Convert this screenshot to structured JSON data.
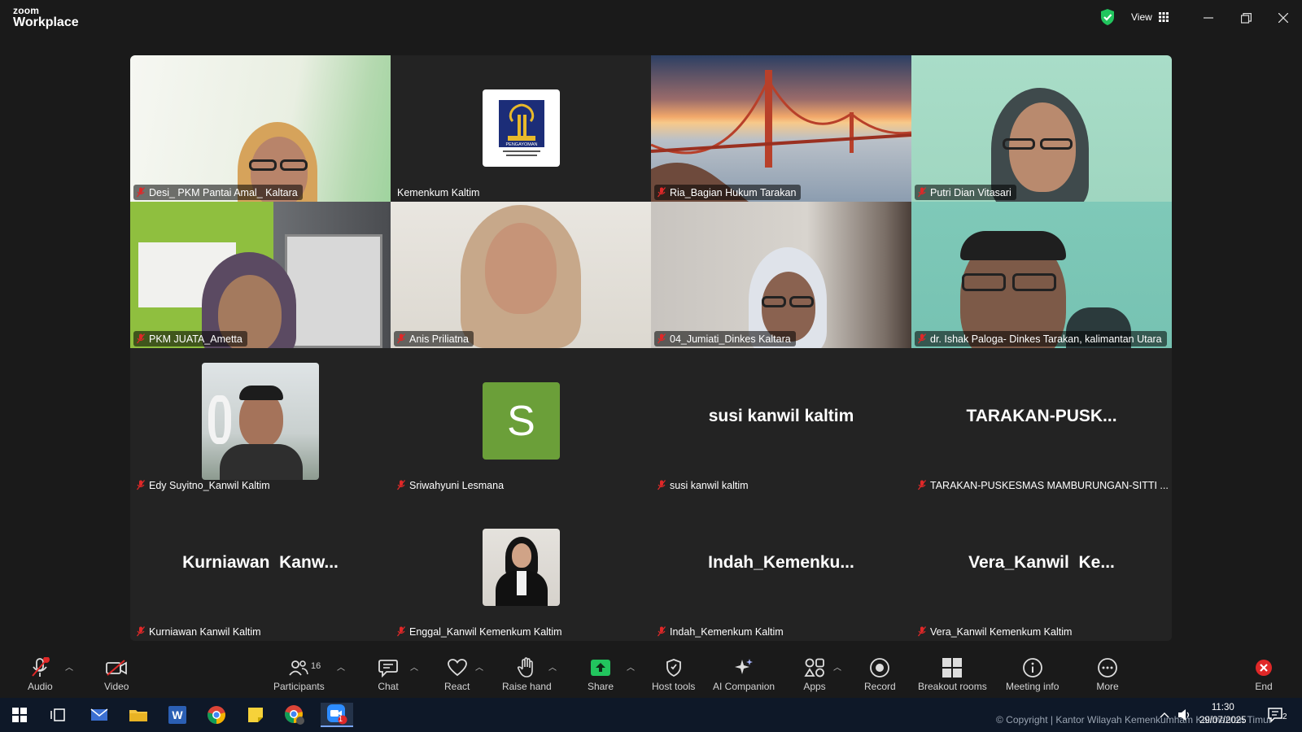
{
  "app": {
    "brand_top": "zoom",
    "brand_bottom": "Workplace",
    "view_label": "View"
  },
  "participants": [
    {
      "name": "Desi_ PKM Pantai Amal_ Kaltara",
      "kind": "video"
    },
    {
      "name": "Kemenkum Kaltim",
      "kind": "logo",
      "logo_text": "PENGAYOMAN"
    },
    {
      "name": "Ria_Bagian Hukum Tarakan",
      "kind": "video",
      "active": true
    },
    {
      "name": "Putri Dian Vitasari",
      "kind": "video"
    },
    {
      "name": "PKM JUATA_Ametta",
      "kind": "video"
    },
    {
      "name": "Anis Priliatna",
      "kind": "video"
    },
    {
      "name": "04_Jumiati_Dinkes Kaltara",
      "kind": "video"
    },
    {
      "name": "dr. Ishak Paloga- Dinkes Tarakan, kalimantan Utara",
      "kind": "video"
    },
    {
      "name": "Edy Suyitno_Kanwil Kaltim",
      "kind": "photo"
    },
    {
      "name": "Sriwahyuni Lesmana",
      "kind": "initial",
      "initial": "S"
    },
    {
      "name": "susi kanwil kaltim",
      "kind": "text",
      "display": "susi kanwil kaltim"
    },
    {
      "name": "TARAKAN-PUSKESMAS MAMBURUNGAN-SITTI ...",
      "kind": "text",
      "display": "TARAKAN-PUSK..."
    },
    {
      "name": "Kurniawan Kanwil Kaltim",
      "kind": "text",
      "display": "Kurniawan  Kanw..."
    },
    {
      "name": "Enggal_Kanwil Kemenkum Kaltim",
      "kind": "photo"
    },
    {
      "name": "Indah_Kemenkum Kaltim",
      "kind": "text",
      "display": "Indah_Kemenku..."
    },
    {
      "name": "Vera_Kanwil Kemenkum Kaltim",
      "kind": "text",
      "display": "Vera_Kanwil  Ke..."
    }
  ],
  "toolbar": {
    "audio": "Audio",
    "video": "Video",
    "participants": "Participants",
    "participants_count": "16",
    "chat": "Chat",
    "react": "React",
    "raise_hand": "Raise hand",
    "share": "Share",
    "host_tools": "Host tools",
    "ai_companion": "AI Companion",
    "apps": "Apps",
    "record": "Record",
    "breakout_rooms": "Breakout rooms",
    "meeting_info": "Meeting info",
    "more": "More",
    "end": "End"
  },
  "taskbar": {
    "copyright": "© Copyright | Kantor Wilayah Kemenkumham Kalimantan Timur",
    "time": "11:30",
    "date": "29/07/2025",
    "notification_count": "2",
    "zoom_badge": "1"
  },
  "colors": {
    "accent_green": "#34d399",
    "share_green": "#22c55e",
    "end_red": "#e02828",
    "muted_red": "#e02828",
    "avatar_green": "#6b9f39"
  }
}
